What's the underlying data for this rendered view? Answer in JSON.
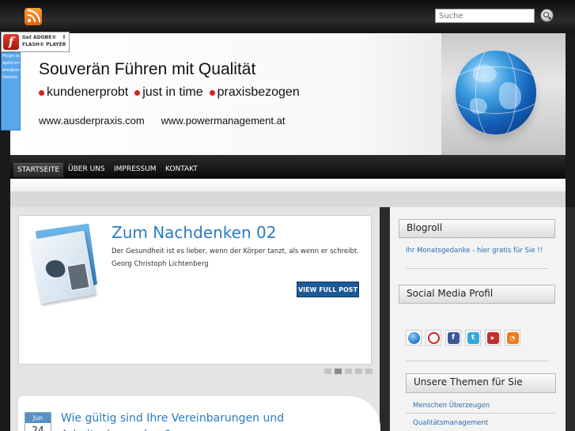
{
  "search": {
    "placeholder": "Suche"
  },
  "flash": {
    "line1": "Get ADOBE®",
    "line2": "FLASH® PLAYER",
    "logo": "f",
    "arrow": "⬇"
  },
  "plugin_panel": [
    "Plugin by",
    "wpforum.com",
    "wordpress",
    "themes"
  ],
  "header": {
    "title": "Souverän Führen mit Qualität",
    "taglines": [
      "kundenerprobt",
      "just in time",
      "praxisbezogen"
    ],
    "urls": [
      "www.ausderpraxis.com",
      "www.powermanagement.at"
    ],
    "bullet_color": "#d42020"
  },
  "nav": {
    "items": [
      "STARTSEITE",
      "ÜBER UNS",
      "IMPRESSUM",
      "KONTAKT"
    ],
    "active_index": 0
  },
  "featured": {
    "title": "Zum Nachdenken 02",
    "text": "Der Gesundheit ist es lieber, wenn der Körper tanzt, als wenn er schreibt. Georg Christoph Lichtenberg",
    "button": "VIEW FULL POST",
    "slides_count": 5,
    "active_slide": 1
  },
  "post": {
    "month": "Jun",
    "day": "24",
    "title": "Wie gültig sind Ihre Vereinbarungen und Arbeitsabsprachen?"
  },
  "sidebar": {
    "blogroll": {
      "title": "Blogroll",
      "link": "Ihr Monatsgedanke - hier gratis für Sie !!"
    },
    "social": {
      "title": "Social Media Profil",
      "icons": [
        {
          "name": "globe-icon",
          "glyph": "",
          "color": "#1f73c8"
        },
        {
          "name": "lastfm-icon",
          "glyph": "",
          "color": "#d42020"
        },
        {
          "name": "facebook-icon",
          "glyph": "f",
          "color": "#3b5998"
        },
        {
          "name": "twitter-icon",
          "glyph": "t",
          "color": "#33a9e0"
        },
        {
          "name": "youtube-icon",
          "glyph": "",
          "color": "#c4302b"
        },
        {
          "name": "rss-icon",
          "glyph": "",
          "color": "#ee7d1e"
        }
      ]
    },
    "themes": {
      "title": "Unsere Themen für Sie",
      "links": [
        "Menschen Überzeugen",
        "Qualitätsmanagement"
      ]
    }
  },
  "colors": {
    "accent": "#2a7bc0",
    "button": "#1b5a96"
  }
}
